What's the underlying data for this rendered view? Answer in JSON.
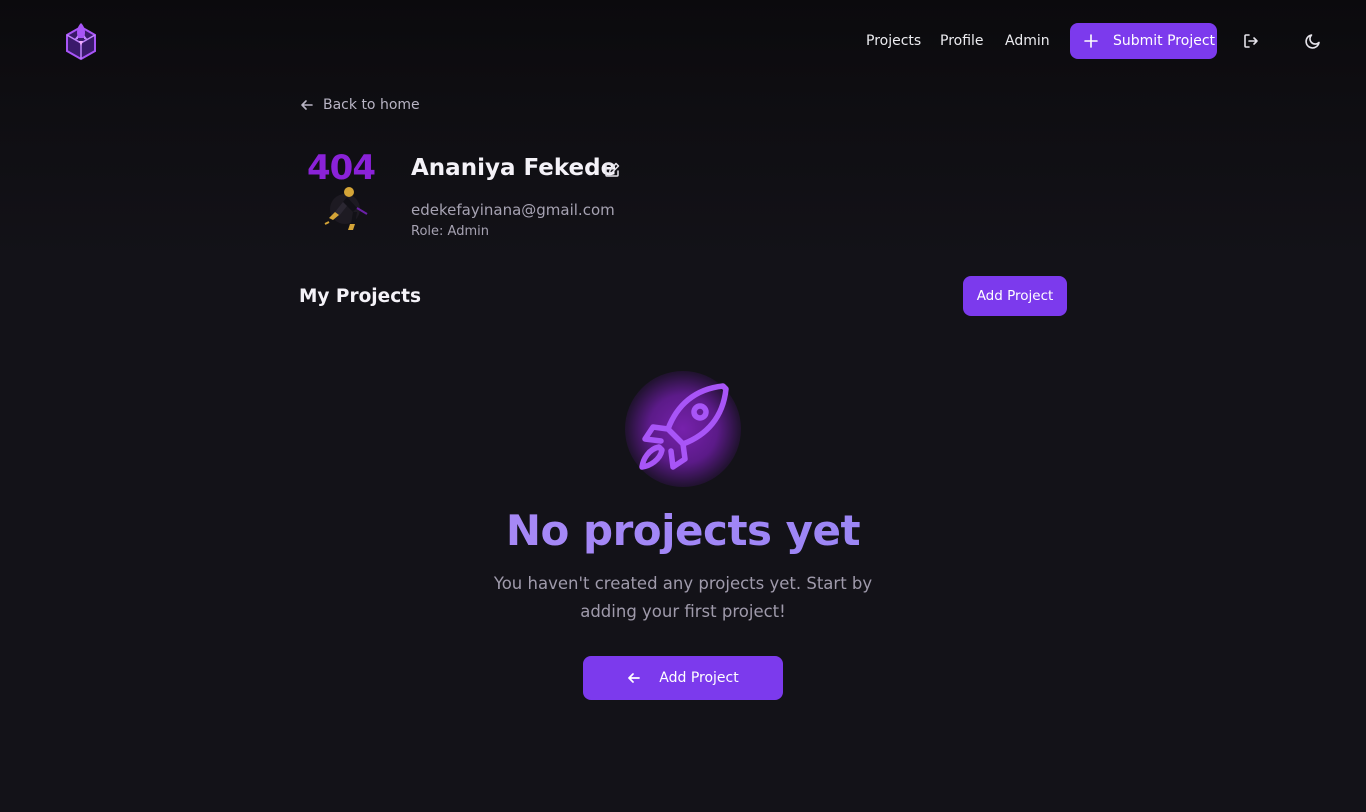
{
  "colors": {
    "accent": "#7c3aed",
    "background": "#131218",
    "header": "#0b0a0d",
    "title_gradient_start": "#b68cf7",
    "title_gradient_end": "#8c84f0"
  },
  "header": {
    "logo_icon": "rocket-cube-logo-icon",
    "nav": [
      "Projects",
      "Profile",
      "Admin"
    ],
    "submit_label": "Submit Project",
    "submit_icon": "plus-icon",
    "logout_icon": "logout-icon",
    "theme_icon": "moon-icon"
  },
  "profile": {
    "back_label": "Back to home",
    "avatar_text": "404",
    "name": "Ananiya Fekede",
    "email": "edekefayinana@gmail.com",
    "role": "Role: Admin"
  },
  "projects": {
    "title": "My Projects",
    "add_label": "Add Project"
  },
  "empty_state": {
    "icon": "rocket-icon",
    "title": "No projects yet",
    "message": "You haven't created any projects yet. Start by adding your first project!",
    "button_label": "Add Project",
    "button_icon": "arrow-left-icon"
  }
}
